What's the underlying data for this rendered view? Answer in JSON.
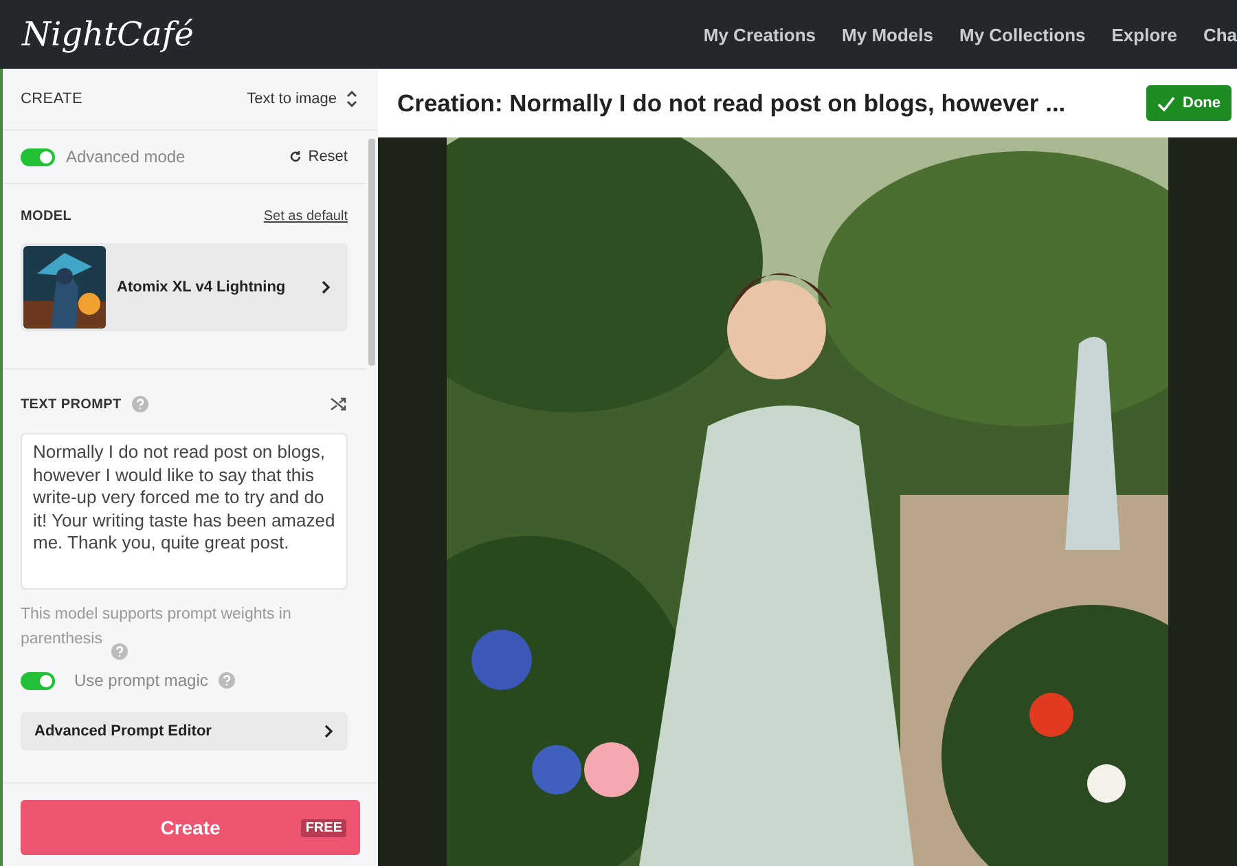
{
  "header": {
    "logo": "NightCafé",
    "nav": [
      "My Creations",
      "My Models",
      "My Collections",
      "Explore",
      "Cha"
    ]
  },
  "sidebar": {
    "section_title": "CREATE",
    "mode_select": "Text to image",
    "advanced_mode": {
      "label": "Advanced mode",
      "on": true
    },
    "reset": "Reset",
    "model": {
      "heading": "MODEL",
      "set_default": "Set as default",
      "name": "Atomix XL v4 Lightning"
    },
    "prompt": {
      "heading": "TEXT PROMPT",
      "value": "Normally I do not read post on blogs, however I would like to say that this write-up very forced me to try and do it! Your writing taste has been amazed me. Thank you, quite great post.",
      "hint": "This model supports prompt weights in parenthesis"
    },
    "prompt_magic": {
      "label": "Use prompt magic",
      "on": true
    },
    "advanced_editor": "Advanced Prompt Editor",
    "create_button": {
      "label": "Create",
      "badge": "FREE"
    }
  },
  "main": {
    "title": "Creation: Normally I do not read post on blogs, however ...",
    "done_button": "Done"
  }
}
